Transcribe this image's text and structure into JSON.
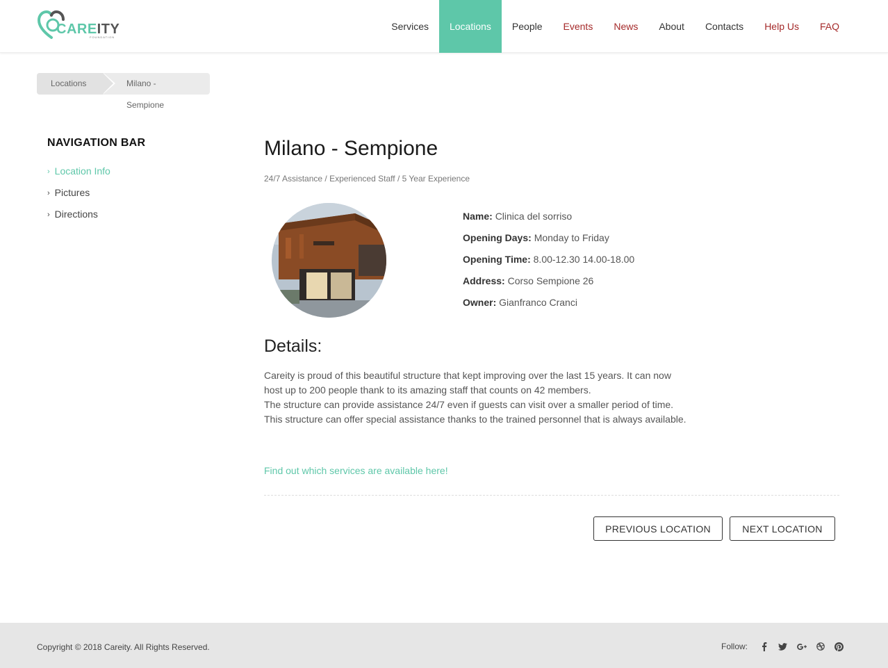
{
  "brand": {
    "logo_main_1": "CARE",
    "logo_main_2": "ITY",
    "logo_sub": "FOUNDATION"
  },
  "nav": {
    "items": [
      {
        "label": "Services"
      },
      {
        "label": "Locations"
      },
      {
        "label": "People"
      },
      {
        "label": "Events"
      },
      {
        "label": "News"
      },
      {
        "label": "About"
      },
      {
        "label": "Contacts"
      },
      {
        "label": "Help Us"
      },
      {
        "label": "FAQ"
      }
    ]
  },
  "breadcrumb": {
    "items": [
      "Locations",
      "Milano - Sempione"
    ]
  },
  "sidebar": {
    "title": "NAVIGATION BAR",
    "items": [
      "Location Info",
      "Pictures",
      "Directions"
    ]
  },
  "location": {
    "title": "Milano - Sempione",
    "tags": [
      "24/7 Assistance",
      "/ Experienced Staff",
      "/ 5 Year Experience"
    ],
    "info": [
      {
        "label": "Name:",
        "value": "Clinica del sorriso"
      },
      {
        "label": "Opening Days:",
        "value": "Monday to Friday"
      },
      {
        "label": "Opening Time:",
        "value": "8.00-12.30 14.00-18.00"
      },
      {
        "label": "Address:",
        "value": "Corso Sempione 26"
      },
      {
        "label": "Owner:",
        "value": "Gianfranco Cranci"
      }
    ],
    "details_title": "Details:",
    "details_lines": [
      "Careity is proud of this beautiful structure that kept improving over the last 15 years. It can now",
      "host up to 200 people thank to its amazing staff that counts on 42 members.",
      "The structure can provide assistance 24/7 even if guests can visit over a smaller period of time.",
      "This structure can offer special assistance thanks to the trained personnel that is always available."
    ],
    "services_link": "Find out which services are available here!"
  },
  "pager": {
    "prev": "PREVIOUS LOCATION",
    "next": "NEXT LOCATION"
  },
  "footer": {
    "copyright": "Copyright © 2018 Careity. All Rights Reserved.",
    "follow_label": "Follow:",
    "social_icons": [
      "facebook-icon",
      "twitter-icon",
      "google-plus-icon",
      "dribbble-icon",
      "pinterest-icon"
    ]
  },
  "colors": {
    "accent": "#5ec7a9",
    "nav_red": "#a52a2a",
    "footer_bg": "#e6e6e6"
  }
}
